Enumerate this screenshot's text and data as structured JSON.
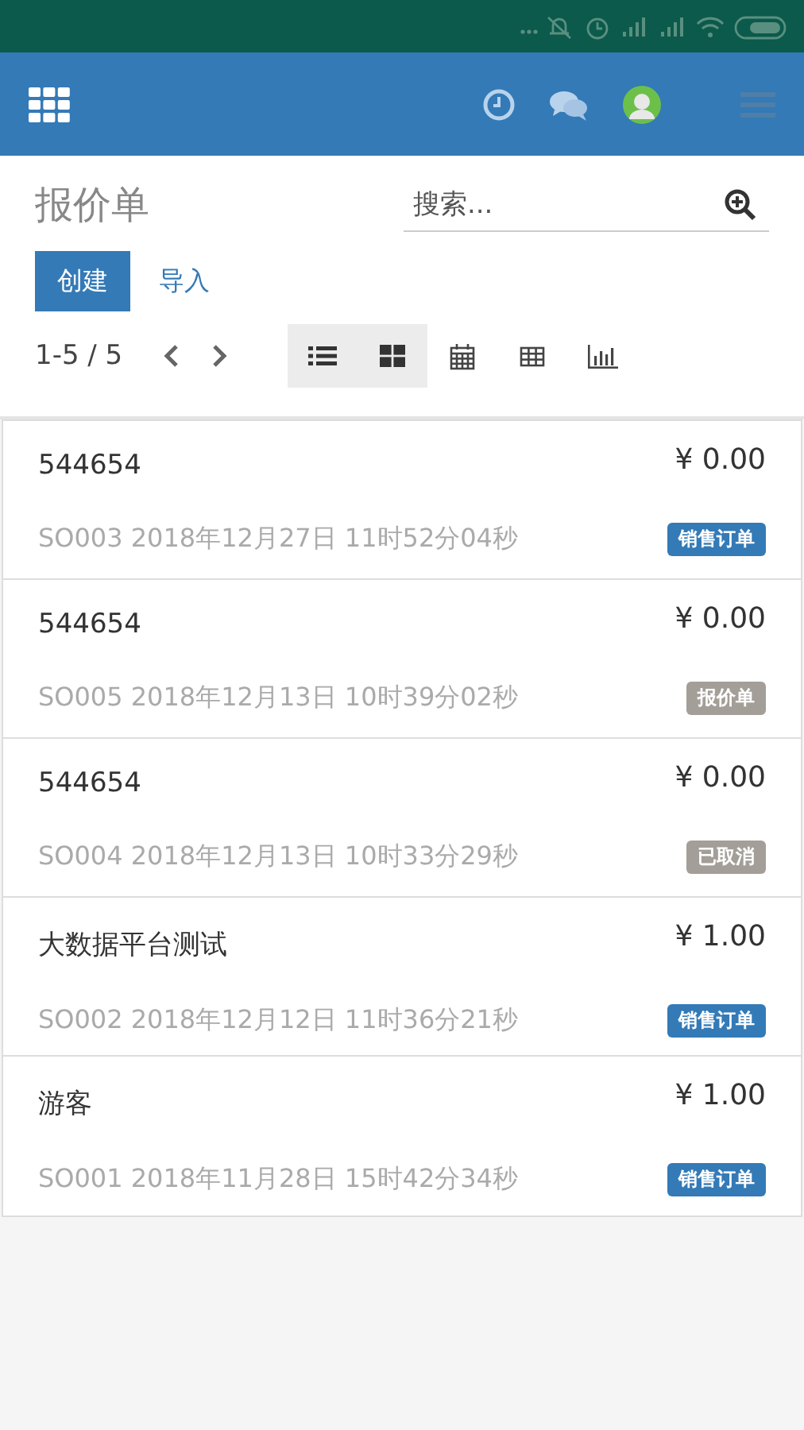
{
  "title": "报价单",
  "search": {
    "placeholder": "搜索..."
  },
  "buttons": [
    {
      "label": "创建",
      "kind": "primary"
    },
    {
      "label": "导入",
      "kind": "link"
    }
  ],
  "pager": {
    "text": "1-5 / 5"
  },
  "views": [
    {
      "kind": "list",
      "selected": true
    },
    {
      "kind": "kanban",
      "selected": true
    },
    {
      "kind": "calendar",
      "selected": false
    },
    {
      "kind": "pivot",
      "selected": false
    },
    {
      "kind": "graph",
      "selected": false
    }
  ],
  "records": [
    {
      "name": "544654",
      "amount": "¥ 0.00",
      "ref": "SO003 2018年12月27日 11时52分04秒",
      "tag": "销售订单",
      "color": "#337ab7"
    },
    {
      "name": "544654",
      "amount": "¥ 0.00",
      "ref": "SO005 2018年12月13日 10时39分02秒",
      "tag": "报价单",
      "color": "#a39e98"
    },
    {
      "name": "544654",
      "amount": "¥ 0.00",
      "ref": "SO004 2018年12月13日 10时33分29秒",
      "tag": "已取消",
      "color": "#a39e98"
    },
    {
      "name": "大数据平台测试",
      "amount": "¥ 1.00",
      "ref": "SO002 2018年12月12日 11时36分21秒",
      "tag": "销售订单",
      "color": "#337ab7"
    },
    {
      "name": "游客",
      "amount": "¥ 1.00",
      "ref": "SO001 2018年11月28日 15时42分34秒",
      "tag": "销售订单",
      "color": "#337ab7"
    }
  ]
}
